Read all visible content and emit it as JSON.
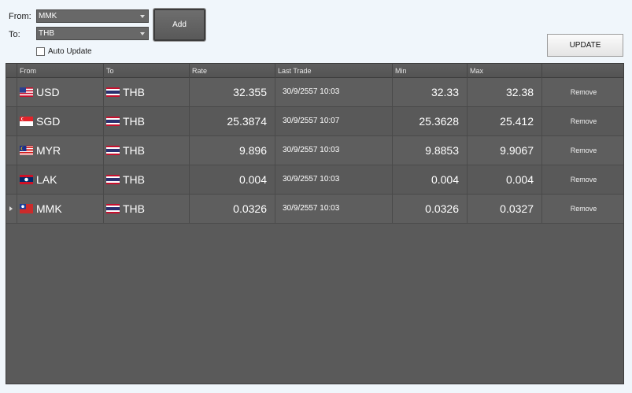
{
  "form": {
    "from_label": "From:",
    "from_value": "MMK",
    "to_label": "To:",
    "to_value": "THB",
    "add_label": "Add",
    "auto_update_label": "Auto Update",
    "auto_update_checked": false,
    "update_label": "UPDATE"
  },
  "grid": {
    "columns": [
      "From",
      "To",
      "Rate",
      "Last Trade",
      "Min",
      "Max"
    ],
    "rows": [
      {
        "from": "USD",
        "from_flag": "us-flag-icon",
        "to": "THB",
        "to_flag": "th-flag-icon",
        "rate": "32.355",
        "last_trade": "30/9/2557 10:03",
        "min": "32.33",
        "max": "32.38",
        "action": "Remove"
      },
      {
        "from": "SGD",
        "from_flag": "sg-flag-icon",
        "to": "THB",
        "to_flag": "th-flag-icon",
        "rate": "25.3874",
        "last_trade": "30/9/2557 10:07",
        "min": "25.3628",
        "max": "25.412",
        "action": "Remove"
      },
      {
        "from": "MYR",
        "from_flag": "my-flag-icon",
        "to": "THB",
        "to_flag": "th-flag-icon",
        "rate": "9.896",
        "last_trade": "30/9/2557 10:03",
        "min": "9.8853",
        "max": "9.9067",
        "action": "Remove"
      },
      {
        "from": "LAK",
        "from_flag": "la-flag-icon",
        "to": "THB",
        "to_flag": "th-flag-icon",
        "rate": "0.004",
        "last_trade": "30/9/2557 10:03",
        "min": "0.004",
        "max": "0.004",
        "action": "Remove"
      },
      {
        "from": "MMK",
        "from_flag": "mm-flag-icon",
        "to": "THB",
        "to_flag": "th-flag-icon",
        "rate": "0.0326",
        "last_trade": "30/9/2557 10:03",
        "min": "0.0326",
        "max": "0.0327",
        "action": "Remove",
        "current": true
      }
    ]
  },
  "colors": {
    "background": "#f0f6fb",
    "grid_background": "#5a5a5a",
    "row_text": "#ffffff"
  }
}
